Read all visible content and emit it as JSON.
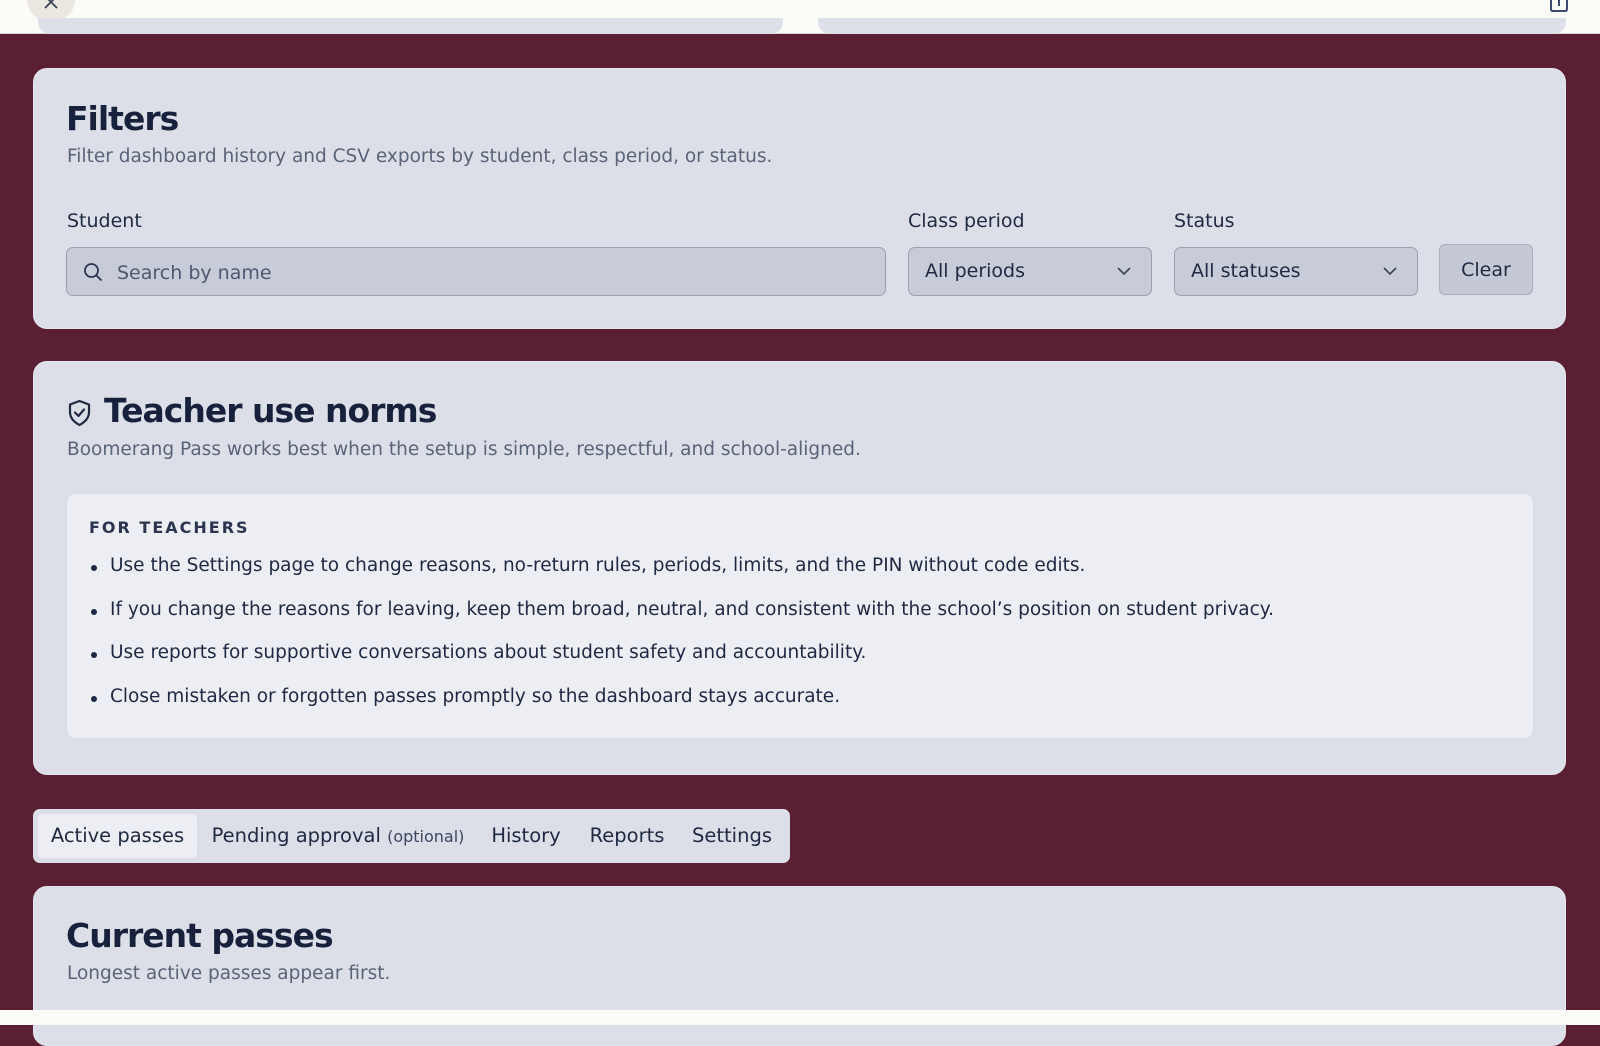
{
  "filters": {
    "title": "Filters",
    "subtitle": "Filter dashboard history and CSV exports by student, class period, or status.",
    "student_label": "Student",
    "student_placeholder": "Search by name",
    "period_label": "Class period",
    "period_value": "All periods",
    "status_label": "Status",
    "status_value": "All statuses",
    "clear_label": "Clear"
  },
  "norms": {
    "title": "Teacher use norms",
    "subtitle": "Boomerang Pass works best when the setup is simple, respectful, and school-aligned.",
    "heading": "FOR TEACHERS",
    "items": [
      "Use the Settings page to change reasons, no-return rules, periods, limits, and the PIN without code edits.",
      "If you change the reasons for leaving, keep them broad, neutral, and consistent with the school’s position on student privacy.",
      "Use reports for supportive conversations about student safety and accountability.",
      "Close mistaken or forgotten passes promptly so the dashboard stays accurate."
    ]
  },
  "tabs": {
    "active": "Active passes",
    "pending": "Pending approval",
    "pending_note": "(optional)",
    "history": "History",
    "reports": "Reports",
    "settings": "Settings"
  },
  "current": {
    "title": "Current passes",
    "subtitle": "Longest active passes appear first."
  },
  "icons": {
    "close": "close-icon",
    "share": "share-icon",
    "search": "search-icon",
    "chevron": "chevron-down-icon",
    "shield": "shield-check-icon"
  },
  "colors": {
    "background": "#5b1f33",
    "card": "#dcdfe8",
    "text": "#17213b"
  }
}
